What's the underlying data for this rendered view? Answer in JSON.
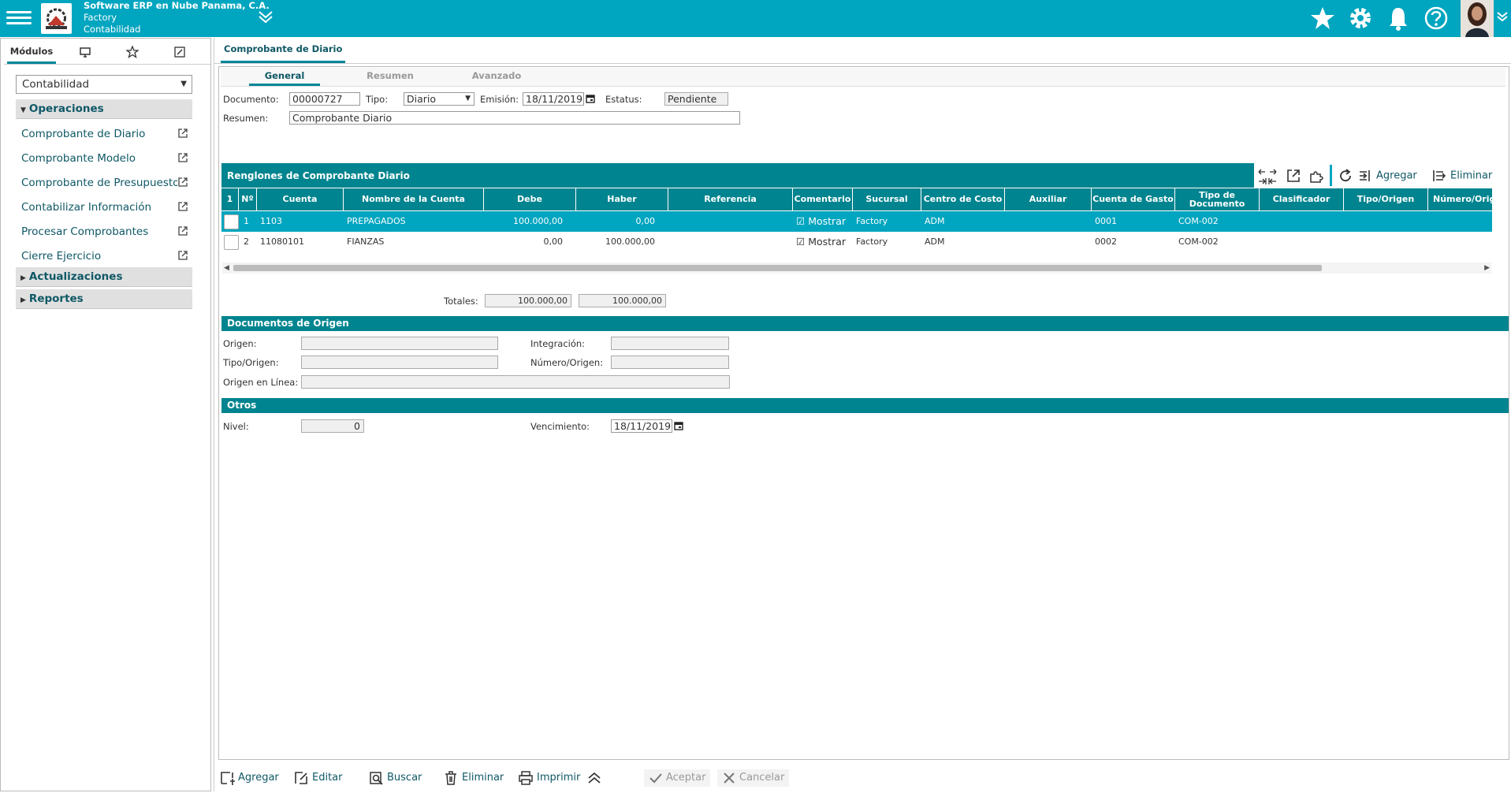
{
  "header": {
    "company": "Software ERP en Nube Panama, C.A.",
    "branch": "Factory",
    "module": "Contabilidad"
  },
  "left": {
    "tabs": [
      "Módulos"
    ],
    "select_value": "Contabilidad",
    "groups": {
      "operaciones": "Operaciones",
      "actualizaciones": "Actualizaciones",
      "reportes": "Reportes"
    },
    "items": [
      "Comprobante de Diario",
      "Comprobante Modelo",
      "Comprobante de Presupuesto",
      "Contabilizar Información",
      "Procesar Comprobantes",
      "Cierre Ejercicio"
    ]
  },
  "main": {
    "tab": "Comprobante de Diario",
    "subtabs": [
      "General",
      "Resumen",
      "Avanzado"
    ],
    "form": {
      "documento_label": "Documento:",
      "documento": "00000727",
      "tipo_label": "Tipo:",
      "tipo": "Diario",
      "emision_label": "Emisión:",
      "emision": "18/11/2019",
      "estatus_label": "Estatus:",
      "estatus": "Pendiente",
      "resumen_label": "Resumen:",
      "resumen": "Comprobante Diario"
    },
    "grid": {
      "title": "Renglones de Comprobante Diario",
      "agregar": "Agregar",
      "eliminar": "Eliminar",
      "headers": [
        "1",
        "Nº",
        "Cuenta",
        "Nombre de la Cuenta",
        "Debe",
        "Haber",
        "Referencia",
        "Comentario",
        "Sucursal",
        "Centro de Costo",
        "Auxiliar",
        "Cuenta de Gasto",
        "Tipo de Documento",
        "Clasificador",
        "Tipo/Origen",
        "Número/Origen"
      ],
      "rows": [
        {
          "n": "1",
          "cuenta": "1103",
          "nombre": "PREPAGADOS",
          "debe": "100.000,00",
          "haber": "0,00",
          "referencia": "",
          "comentario": "Mostrar",
          "sucursal": "Factory",
          "centro": "ADM",
          "auxiliar": "",
          "gasto": "0001",
          "tipodoc": "COM-002"
        },
        {
          "n": "2",
          "cuenta": "11080101",
          "nombre": "FIANZAS",
          "debe": "0,00",
          "haber": "100.000,00",
          "referencia": "",
          "comentario": "Mostrar",
          "sucursal": "Factory",
          "centro": "ADM",
          "auxiliar": "",
          "gasto": "0002",
          "tipodoc": "COM-002"
        }
      ],
      "totales_label": "Totales:",
      "total_debe": "100.000,00",
      "total_haber": "100.000,00"
    },
    "origen": {
      "title": "Documentos de Origen",
      "origen_label": "Origen:",
      "integracion_label": "Integración:",
      "tipo_origen_label": "Tipo/Origen:",
      "numero_origen_label": "Número/Origen:",
      "linea_label": "Origen en Línea:"
    },
    "otros": {
      "title": "Otros",
      "nivel_label": "Nivel:",
      "nivel": "0",
      "venc_label": "Vencimiento:",
      "venc": "18/11/2019"
    }
  },
  "bottom": {
    "agregar": "Agregar",
    "editar": "Editar",
    "buscar": "Buscar",
    "eliminar": "Eliminar",
    "imprimir": "Imprimir",
    "aceptar": "Aceptar",
    "cancelar": "Cancelar"
  },
  "colors": {
    "header": "#00a5bf",
    "section": "#00848f",
    "text_accent": "#0f5866"
  }
}
